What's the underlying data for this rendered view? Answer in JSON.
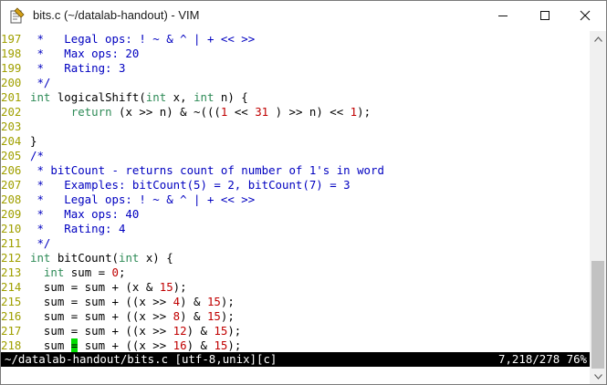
{
  "window": {
    "title": "bits.c (~/datalab-handout) - VIM",
    "icon": "vim-icon",
    "controls": [
      "minimize-icon",
      "maximize-icon",
      "close-icon"
    ]
  },
  "colors": {
    "comment": "#0000c0",
    "keyword": "#2e8b57",
    "number": "#c00000",
    "line_number": "#a0a000",
    "cursor": "#00dd00",
    "statusline_bg": "#000000"
  },
  "editor": {
    "lines": [
      {
        "num": "197",
        "tokens": [
          [
            "cm",
            " *   Legal ops: ! ~ & ^ | + << >>"
          ]
        ]
      },
      {
        "num": "198",
        "tokens": [
          [
            "cm",
            " *   Max ops: 20"
          ]
        ]
      },
      {
        "num": "199",
        "tokens": [
          [
            "cm",
            " *   Rating: 3"
          ]
        ]
      },
      {
        "num": "200",
        "tokens": [
          [
            "cm",
            " */"
          ]
        ]
      },
      {
        "num": "201",
        "tokens": [
          [
            "ty",
            "int"
          ],
          [
            "pl",
            " logicalShift("
          ],
          [
            "ty",
            "int"
          ],
          [
            "pl",
            " x, "
          ],
          [
            "ty",
            "int"
          ],
          [
            "pl",
            " n) {"
          ]
        ]
      },
      {
        "num": "202",
        "tokens": [
          [
            "pl",
            "      "
          ],
          [
            "kw",
            "return"
          ],
          [
            "pl",
            " (x >> n) & ~((("
          ],
          [
            "num",
            "1"
          ],
          [
            "pl",
            " << "
          ],
          [
            "num",
            "31"
          ],
          [
            "pl",
            " ) >> n) << "
          ],
          [
            "num",
            "1"
          ],
          [
            "pl",
            ");"
          ]
        ]
      },
      {
        "num": "203",
        "tokens": []
      },
      {
        "num": "204",
        "tokens": [
          [
            "pl",
            "}"
          ]
        ]
      },
      {
        "num": "205",
        "tokens": [
          [
            "cm",
            "/*"
          ]
        ]
      },
      {
        "num": "206",
        "tokens": [
          [
            "cm",
            " * bitCount - returns count of number of 1's in word"
          ]
        ]
      },
      {
        "num": "207",
        "tokens": [
          [
            "cm",
            " *   Examples: bitCount(5) = 2, bitCount(7) = 3"
          ]
        ]
      },
      {
        "num": "208",
        "tokens": [
          [
            "cm",
            " *   Legal ops: ! ~ & ^ | + << >>"
          ]
        ]
      },
      {
        "num": "209",
        "tokens": [
          [
            "cm",
            " *   Max ops: 40"
          ]
        ]
      },
      {
        "num": "210",
        "tokens": [
          [
            "cm",
            " *   Rating: 4"
          ]
        ]
      },
      {
        "num": "211",
        "tokens": [
          [
            "cm",
            " */"
          ]
        ]
      },
      {
        "num": "212",
        "tokens": [
          [
            "ty",
            "int"
          ],
          [
            "pl",
            " bitCount("
          ],
          [
            "ty",
            "int"
          ],
          [
            "pl",
            " x) {"
          ]
        ]
      },
      {
        "num": "213",
        "tokens": [
          [
            "pl",
            "  "
          ],
          [
            "ty",
            "int"
          ],
          [
            "pl",
            " sum = "
          ],
          [
            "num",
            "0"
          ],
          [
            "pl",
            ";"
          ]
        ]
      },
      {
        "num": "214",
        "tokens": [
          [
            "pl",
            "  sum = sum + (x & "
          ],
          [
            "num",
            "15"
          ],
          [
            "pl",
            ");"
          ]
        ]
      },
      {
        "num": "215",
        "tokens": [
          [
            "pl",
            "  sum = sum + ((x >> "
          ],
          [
            "num",
            "4"
          ],
          [
            "pl",
            ") & "
          ],
          [
            "num",
            "15"
          ],
          [
            "pl",
            ");"
          ]
        ]
      },
      {
        "num": "216",
        "tokens": [
          [
            "pl",
            "  sum = sum + ((x >> "
          ],
          [
            "num",
            "8"
          ],
          [
            "pl",
            ") & "
          ],
          [
            "num",
            "15"
          ],
          [
            "pl",
            ");"
          ]
        ]
      },
      {
        "num": "217",
        "tokens": [
          [
            "pl",
            "  sum = sum + ((x >> "
          ],
          [
            "num",
            "12"
          ],
          [
            "pl",
            ") & "
          ],
          [
            "num",
            "15"
          ],
          [
            "pl",
            ");"
          ]
        ]
      },
      {
        "num": "218",
        "tokens": [
          [
            "pl",
            "  sum "
          ],
          [
            "cur",
            "="
          ],
          [
            "pl",
            " sum + ((x >> "
          ],
          [
            "num",
            "16"
          ],
          [
            "pl",
            ") & "
          ],
          [
            "num",
            "15"
          ],
          [
            "pl",
            ");"
          ]
        ]
      }
    ]
  },
  "status": {
    "file": "~/datalab-handout/bits.c [utf-8,unix][c]",
    "position": "7,218/278 76%"
  },
  "scrollbar": {
    "thumb_start_fraction": 0.665,
    "thumb_end_fraction": 1.0
  }
}
